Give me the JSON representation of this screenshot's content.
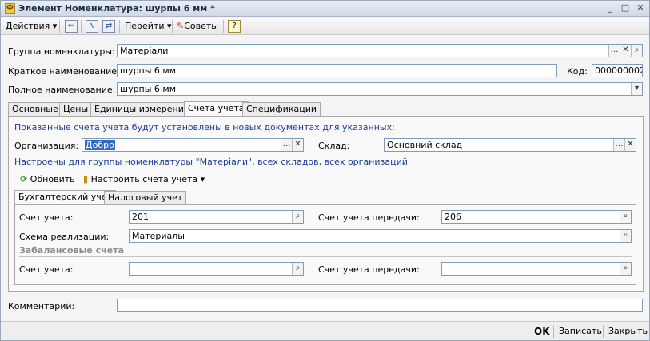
{
  "window": {
    "title": "Элемент Номенклатура: шурпы 6 мм *",
    "icon": "Ф"
  },
  "toolbar": {
    "actions": "Действия",
    "goto": "Перейти",
    "tips": "Советы",
    "help": "?"
  },
  "form": {
    "group_label": "Группа номенклатуры:",
    "group_value": "Матеріали",
    "short_name_label": "Краткое наименование:",
    "short_name_value": "шурпы 6 мм",
    "code_label": "Код:",
    "code_value": "000000002",
    "full_name_label": "Полное наименование:",
    "full_name_value": "шурпы 6 мм"
  },
  "tabs": [
    "Основные",
    "Цены",
    "Единицы измерения",
    "Счета учета",
    "Спецификации"
  ],
  "accounts": {
    "info": "Показанные счета учета будут установлены в новых документах для указанных:",
    "org_label": "Организация:",
    "org_value": "Добро",
    "warehouse_label": "Склад:",
    "warehouse_value": "Основний склад",
    "settings_caption": "Настроены для группы номенклатуры \"Матеріали\", всех складов, всех организаций",
    "refresh": "Обновить",
    "configure": "Настроить счета учета",
    "subtabs": [
      "Бухгалтерский учет",
      "Налоговый учет"
    ],
    "account_label": "Счет учета:",
    "account_value": "201",
    "transfer_label": "Счет учета передачи:",
    "transfer_value": "206",
    "scheme_label": "Схема реализации:",
    "scheme_value": "Материалы",
    "offbalance_heading": "Забалансовые счета",
    "off_account_label": "Счет учета:",
    "off_account_value": "",
    "off_transfer_label": "Счет учета передачи:",
    "off_transfer_value": ""
  },
  "comment": {
    "label": "Комментарий:",
    "value": ""
  },
  "footer": {
    "ok": "OK",
    "save": "Записать",
    "close": "Закрыть"
  }
}
